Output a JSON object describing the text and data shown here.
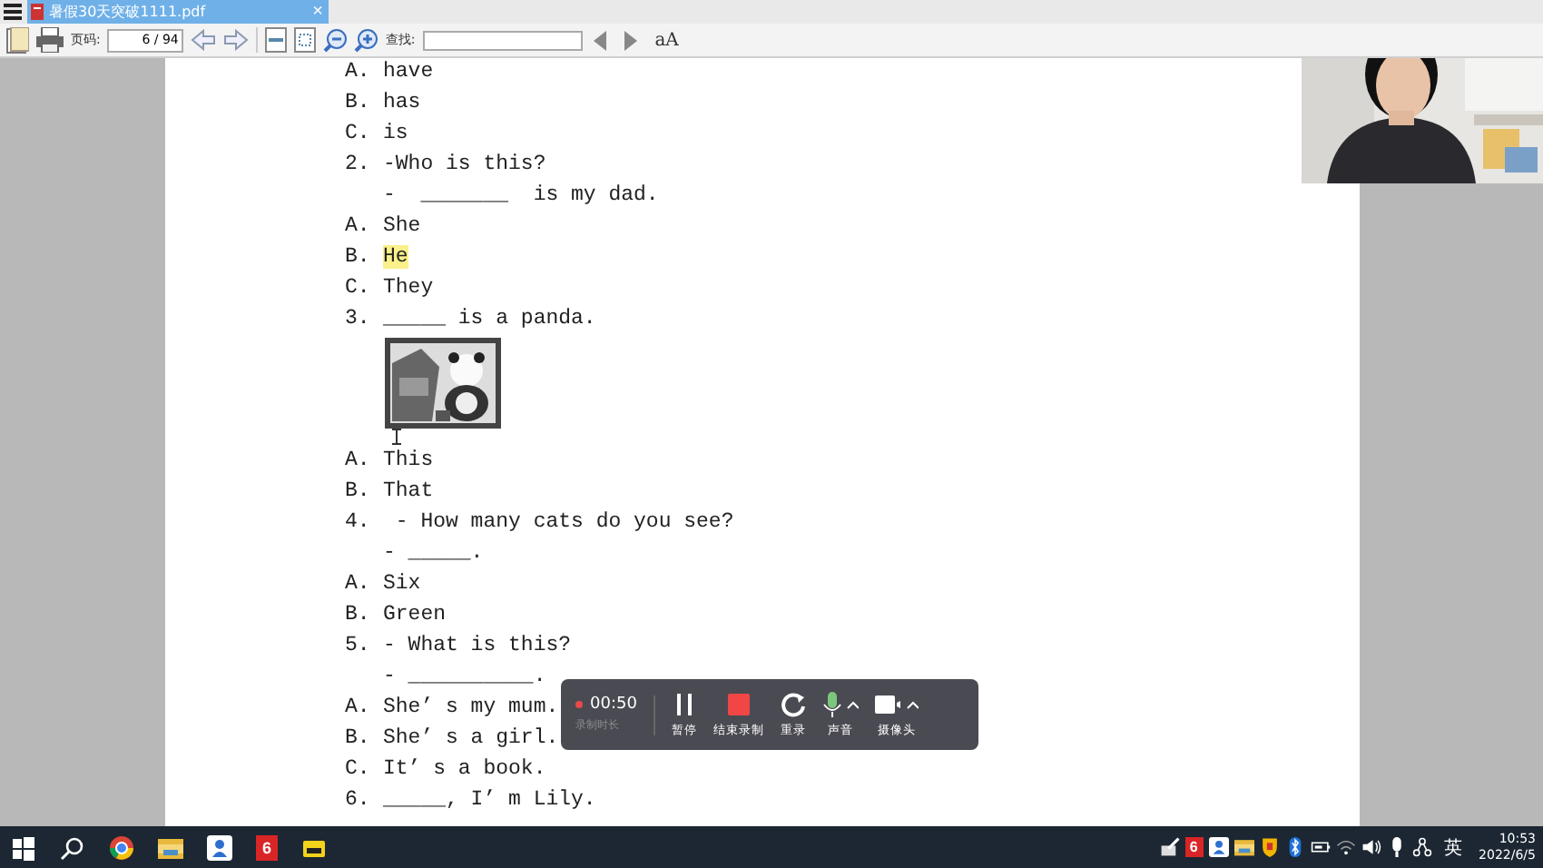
{
  "window": {
    "tab_title": "暑假30天突破1111.pdf",
    "tab_close": "×"
  },
  "toolbar": {
    "page_label": "页码:",
    "page_value": "6 / 94",
    "find_label": "查找:",
    "font_button": "aA"
  },
  "document": {
    "lines": [
      {
        "kind": "text",
        "label": "A.",
        "text": "have",
        "highlighted": false
      },
      {
        "kind": "text",
        "label": "B.",
        "text": "has",
        "highlighted": false
      },
      {
        "kind": "text",
        "label": "C.",
        "text": "is",
        "highlighted": false
      },
      {
        "kind": "text",
        "label": "2.",
        "text": "-Who is this?",
        "highlighted": false
      },
      {
        "kind": "text",
        "text": "-  _______  is my dad.",
        "highlighted": false
      },
      {
        "kind": "text",
        "label": "A.",
        "text": "She",
        "highlighted": false
      },
      {
        "kind": "text",
        "label": "B.",
        "text": "He",
        "highlighted": true
      },
      {
        "kind": "text",
        "label": "C.",
        "text": "They",
        "highlighted": false
      },
      {
        "kind": "text",
        "label": "3.",
        "text": "_____ is a panda.",
        "highlighted": false
      },
      {
        "kind": "picture"
      },
      {
        "kind": "text",
        "label": "A.",
        "text": "This",
        "highlighted": false
      },
      {
        "kind": "text",
        "label": "B.",
        "text": "That",
        "highlighted": false
      },
      {
        "kind": "text",
        "label": "4.",
        "text": " - How many cats do you see?",
        "highlighted": false
      },
      {
        "kind": "text",
        "text": "- _____.",
        "highlighted": false
      },
      {
        "kind": "text",
        "label": "A.",
        "text": "Six",
        "highlighted": false
      },
      {
        "kind": "text",
        "label": "B.",
        "text": "Green",
        "highlighted": false
      },
      {
        "kind": "text",
        "label": "5.",
        "text": "- What is this?",
        "highlighted": false
      },
      {
        "kind": "text",
        "text": "- __________.",
        "highlighted": false
      },
      {
        "kind": "text",
        "label": "A.",
        "text": "She’ s my mum.",
        "highlighted": false
      },
      {
        "kind": "text",
        "label": "B.",
        "text": "She’ s a girl.",
        "highlighted": false
      },
      {
        "kind": "text",
        "label": "C.",
        "text": "It’ s a book.",
        "highlighted": false
      },
      {
        "kind": "text",
        "label": "6.",
        "text": "_____, I’ m Lily.",
        "highlighted": false
      }
    ]
  },
  "recorder": {
    "time": "00:50",
    "time_caption": "录制时长",
    "buttons": [
      {
        "kind": "pause",
        "label": "暂停"
      },
      {
        "kind": "stop",
        "label": "结束录制"
      },
      {
        "kind": "redo",
        "label": "重录"
      },
      {
        "kind": "mic",
        "label": "声音"
      },
      {
        "kind": "camera",
        "label": "摄像头"
      }
    ]
  },
  "taskbar": {
    "apps": [
      {
        "kind": "start"
      },
      {
        "kind": "search"
      },
      {
        "kind": "browser"
      },
      {
        "kind": "folder"
      },
      {
        "kind": "person"
      },
      {
        "kind": "badge",
        "label": "6"
      },
      {
        "kind": "yellow"
      }
    ],
    "tray": [
      {
        "kind": "pen"
      },
      {
        "kind": "badge",
        "label": "6"
      },
      {
        "kind": "person"
      },
      {
        "kind": "folder"
      },
      {
        "kind": "shield"
      },
      {
        "kind": "bluetooth"
      },
      {
        "kind": "battery"
      },
      {
        "kind": "wifi"
      },
      {
        "kind": "volume"
      },
      {
        "kind": "mic"
      },
      {
        "kind": "network"
      }
    ],
    "ime": "英",
    "time": "10:53",
    "date": "2022/6/5"
  }
}
